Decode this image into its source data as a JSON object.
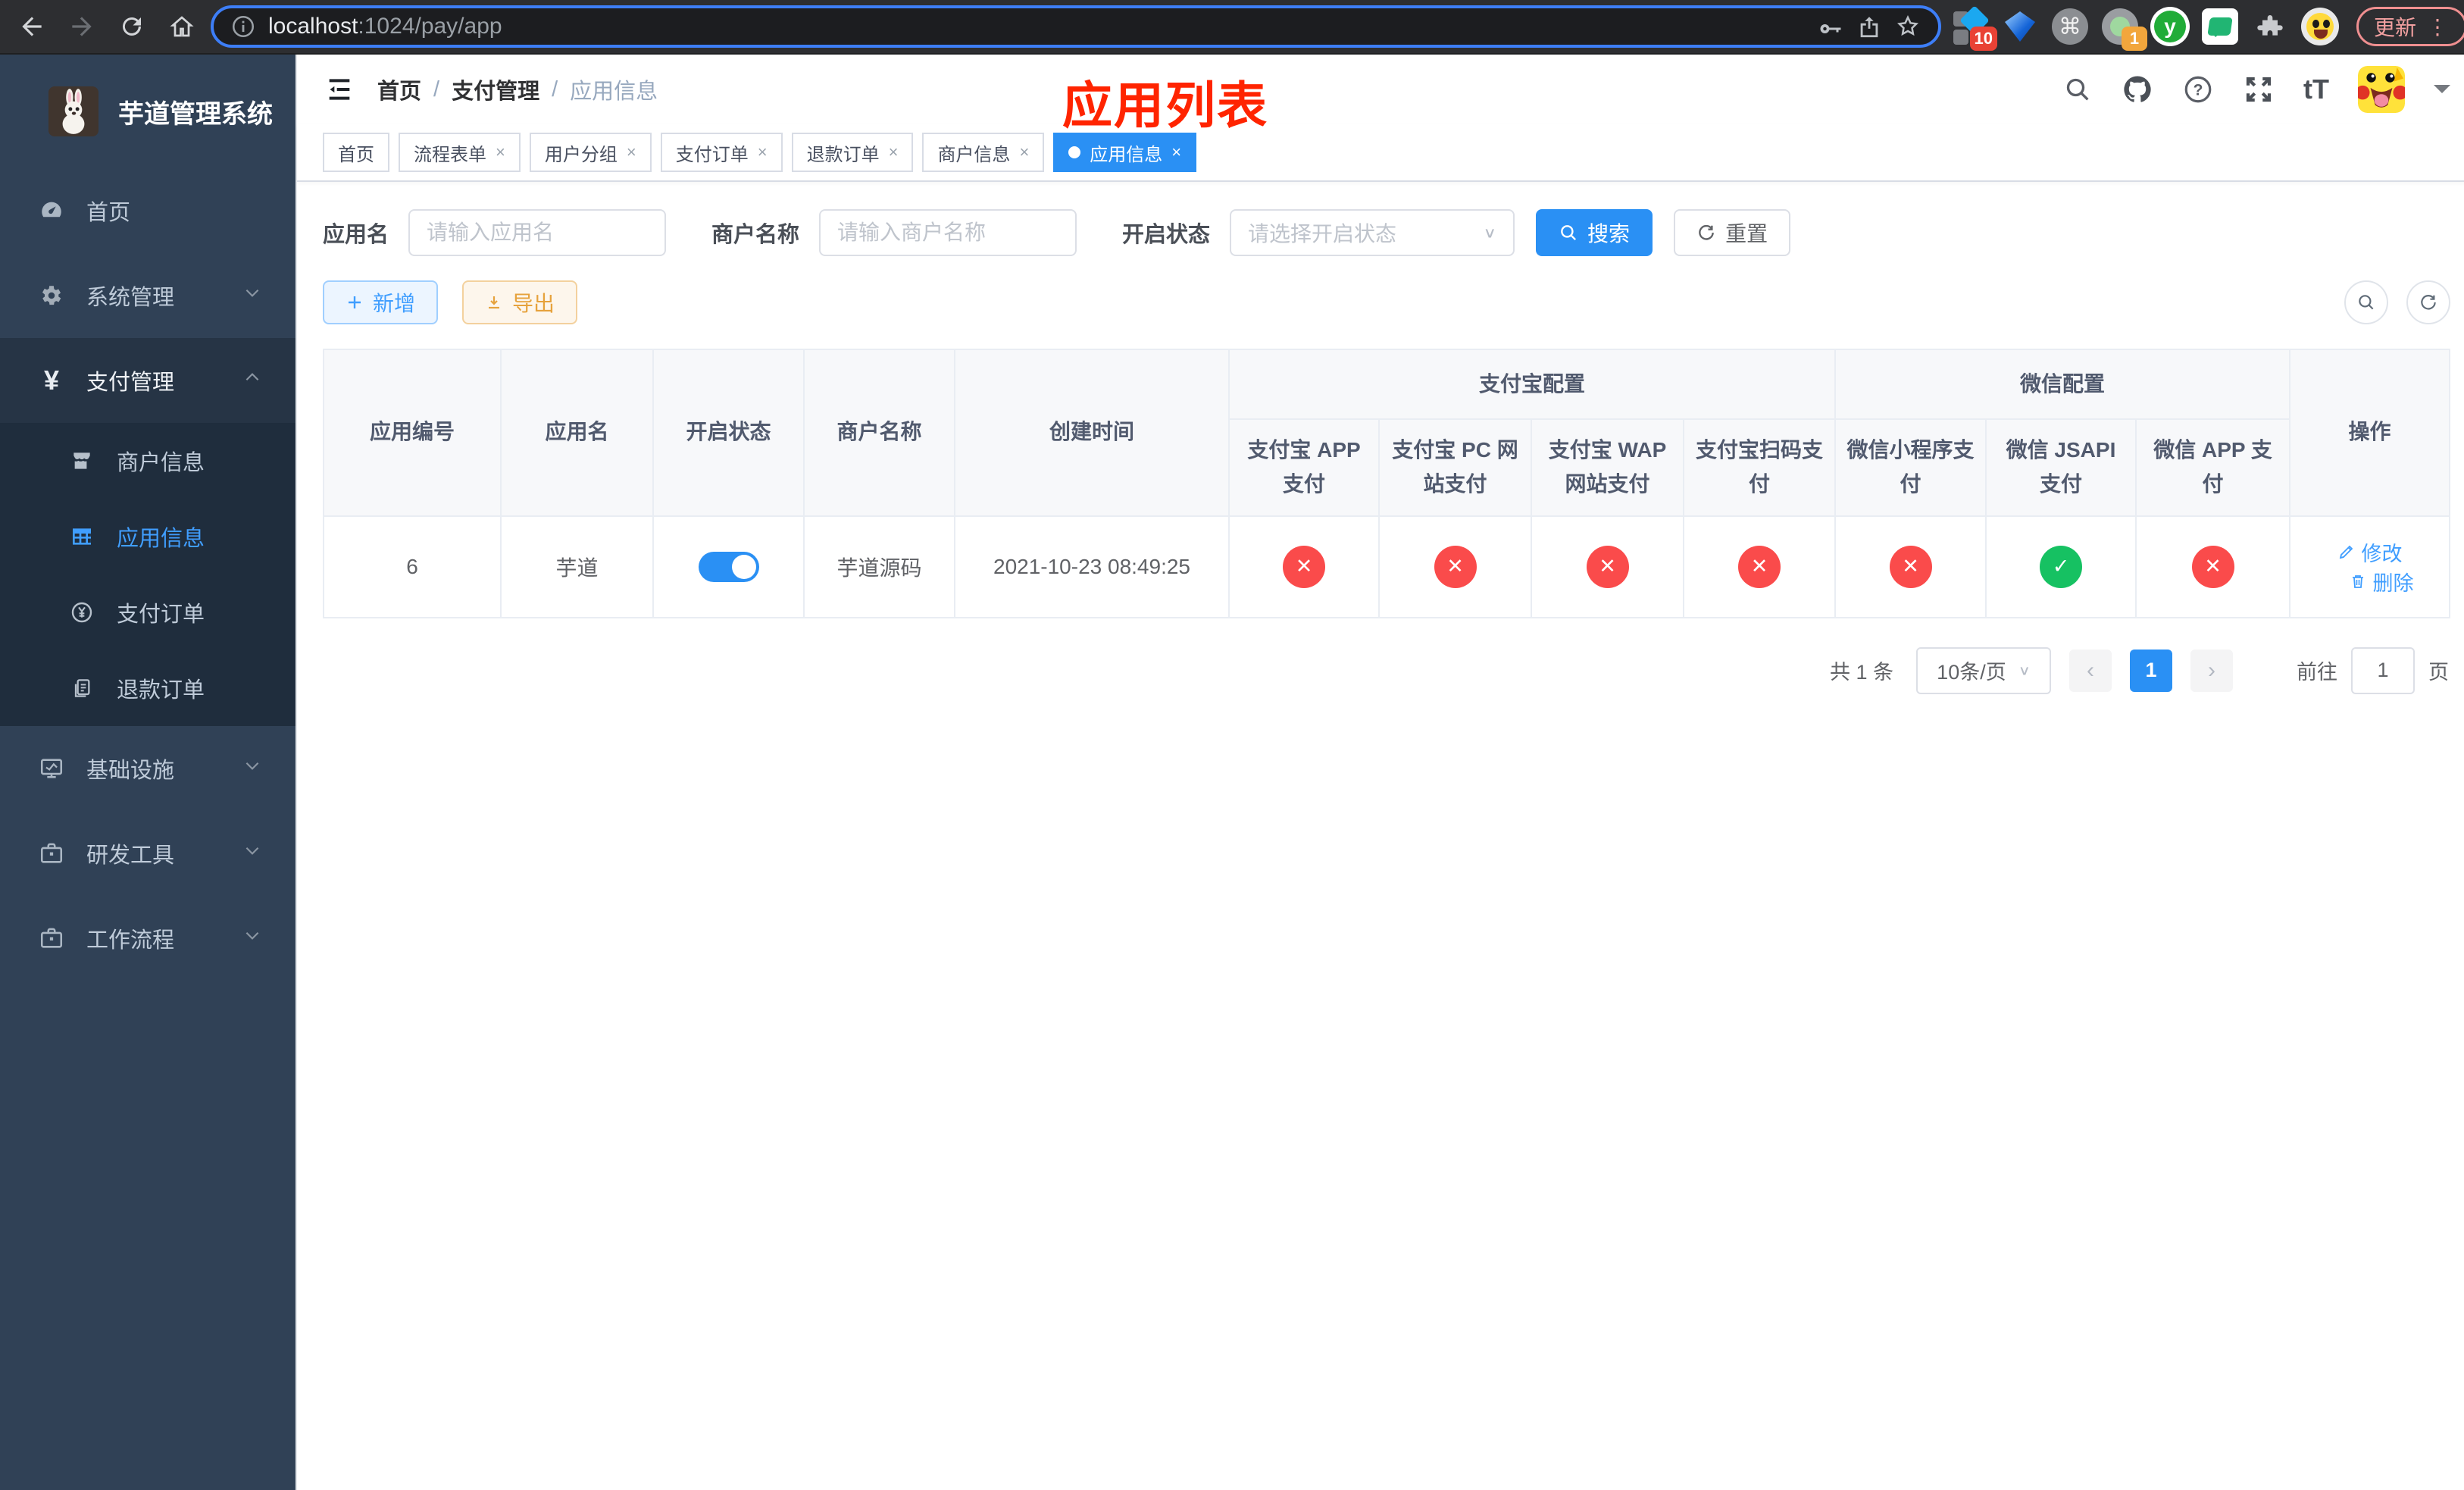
{
  "colors": {
    "accent": "#409eff",
    "success": "#16c162",
    "danger": "#fa4b4b",
    "warning": "#e6a23c",
    "annotation_red": "#ff2400",
    "sidebar_bg": "#304156"
  },
  "browser": {
    "url_host": "localhost",
    "url_rest": ":1024/pay/app",
    "ext_badge_10": "10",
    "ext_badge_1": "1",
    "y_letter": "y",
    "cmd_glyph": "⌘",
    "update_label": "更新",
    "update_dots": "⋮"
  },
  "sidebar": {
    "title": "芋道管理系统",
    "items": [
      {
        "label": "首页"
      },
      {
        "label": "系统管理"
      },
      {
        "label": "支付管理"
      },
      {
        "label": "基础设施"
      },
      {
        "label": "研发工具"
      },
      {
        "label": "工作流程"
      }
    ],
    "submenu": [
      {
        "label": "商户信息"
      },
      {
        "label": "应用信息"
      },
      {
        "label": "支付订单"
      },
      {
        "label": "退款订单"
      }
    ],
    "pay_icon_glyph": "¥"
  },
  "navbar": {
    "breadcrumb": {
      "items": [
        "首页",
        "支付管理",
        "应用信息"
      ],
      "separator": "/"
    },
    "annotation": "应用列表",
    "font_icon": "tT"
  },
  "tabs": [
    {
      "label": "首页"
    },
    {
      "label": "流程表单",
      "close": "×"
    },
    {
      "label": "用户分组",
      "close": "×"
    },
    {
      "label": "支付订单",
      "close": "×"
    },
    {
      "label": "退款订单",
      "close": "×"
    },
    {
      "label": "商户信息",
      "close": "×"
    },
    {
      "label": "应用信息",
      "close": "×"
    }
  ],
  "filters": {
    "app_name_label": "应用名",
    "app_name_placeholder": "请输入应用名",
    "merchant_label": "商户名称",
    "merchant_placeholder": "请输入商户名称",
    "status_label": "开启状态",
    "status_placeholder": "请选择开启状态",
    "search_label": "搜索",
    "reset_label": "重置"
  },
  "toolbar": {
    "add_label": "新增",
    "export_label": "导出"
  },
  "table": {
    "columns": [
      "应用编号",
      "应用名",
      "开启状态",
      "商户名称",
      "创建时间"
    ],
    "groups": {
      "alipay": "支付宝配置",
      "wechat": "微信配置"
    },
    "alipay_cols": [
      "支付宝 APP 支付",
      "支付宝 PC 网站支付",
      "支付宝 WAP 网站支付",
      "支付宝扫码支付"
    ],
    "wechat_cols": [
      "微信小程序支付",
      "微信 JSAPI 支付",
      "微信 APP 支付"
    ],
    "action_col": "操作",
    "row": {
      "id": "6",
      "name": "芋道",
      "enabled": true,
      "merchant": "芋道源码",
      "created": "2021-10-23 08:49:25",
      "pay_cells": [
        {
          "state": "off",
          "symbol": "✕"
        },
        {
          "state": "off",
          "symbol": "✕"
        },
        {
          "state": "off",
          "symbol": "✕"
        },
        {
          "state": "off",
          "symbol": "✕"
        },
        {
          "state": "off",
          "symbol": "✕"
        },
        {
          "state": "on",
          "symbol": "✓"
        },
        {
          "state": "off",
          "symbol": "✕"
        }
      ],
      "edit_label": "修改",
      "delete_label": "删除"
    }
  },
  "pagination": {
    "total": "共 1 条",
    "page_size": "10条/页",
    "prev": "‹",
    "next": "›",
    "page": "1",
    "goto_label": "前往",
    "goto_value": "1",
    "unit": "页"
  }
}
